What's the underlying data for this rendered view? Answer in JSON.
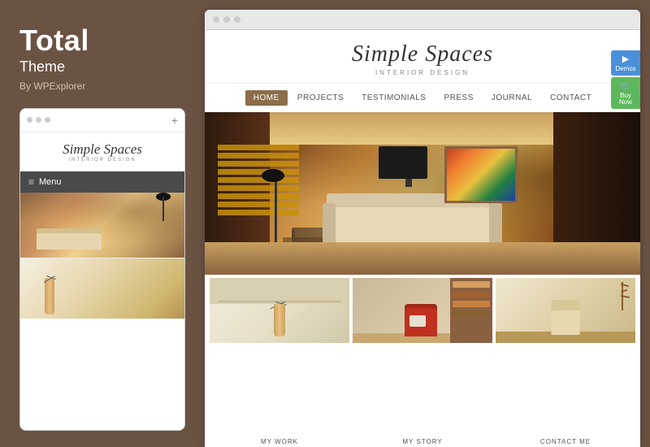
{
  "sidebar": {
    "title": "Total",
    "subtitle": "Theme",
    "by_label": "By WPExplorer",
    "phone": {
      "dots": [
        "dot1",
        "dot2",
        "dot3"
      ],
      "plus_label": "+",
      "logo_text": "Simple Spaces",
      "logo_sub": "INTERIOR DESIGN",
      "menu_label": "Menu"
    }
  },
  "browser": {
    "dots": [
      "dot1",
      "dot2",
      "dot3"
    ],
    "side_buttons": {
      "demos_label": "Demos",
      "demos_icon": "▶",
      "buy_label": "Buy Now",
      "buy_icon": "🛒"
    },
    "website": {
      "logo_text": "Simple Spaces",
      "logo_sub": "INTERIOR DESIGN",
      "nav": {
        "items": [
          {
            "label": "HOME",
            "active": true
          },
          {
            "label": "PROJECTS",
            "active": false
          },
          {
            "label": "TESTIMONIALS",
            "active": false
          },
          {
            "label": "PRESS",
            "active": false
          },
          {
            "label": "JOURNAL",
            "active": false
          },
          {
            "label": "CONTACT",
            "active": false
          }
        ]
      },
      "thumbnails": [
        {
          "label": "MY WORK"
        },
        {
          "label": "MY STORY"
        },
        {
          "label": "CONTACT ME"
        }
      ]
    }
  }
}
